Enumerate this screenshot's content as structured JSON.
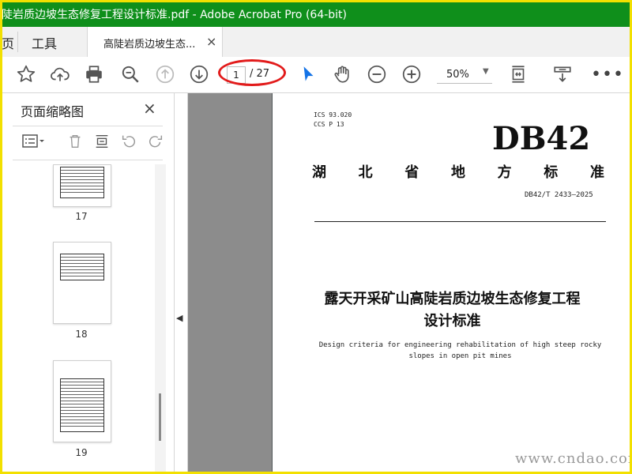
{
  "window": {
    "title": "陡岩质边坡生态修复工程设计标准.pdf - Adobe Acrobat Pro (64-bit)"
  },
  "menu": {
    "left_label": "页",
    "tools_label": "工具"
  },
  "tab": {
    "label": "高陡岩质边坡生态...",
    "close": "×"
  },
  "toolbar": {
    "page_current": "1",
    "page_total": "/ 27",
    "zoom": "50%",
    "zoom_arrow": "▼",
    "more": "•••",
    "icons": [
      "star-icon",
      "cloud-upload-icon",
      "print-icon",
      "search-zoom-icon",
      "page-up-icon",
      "page-down-icon",
      "select-arrow-icon",
      "hand-icon",
      "zoom-out-icon",
      "zoom-in-icon",
      "fit-page-icon",
      "scroll-mode-icon"
    ],
    "accent": "#1473e6",
    "highlight_color": "#e21b1b"
  },
  "sidebar": {
    "header": "页面缩略图",
    "close": "×",
    "thumbnails": [
      {
        "label": "17"
      },
      {
        "label": "18"
      },
      {
        "label": "19"
      }
    ]
  },
  "collapse_arrow": "◀",
  "document": {
    "ics": "ICS  93.020",
    "ccs": "CCS  P 13",
    "db": "DB42",
    "province_chars": [
      "湖",
      "北",
      "省",
      "地",
      "方",
      "标",
      "准"
    ],
    "code": "DB42/T 2433—2025",
    "title_line1": "露天开采矿山高陡岩质边坡生态修复工程",
    "title_line2": "设计标准",
    "english_line1": "Design criteria for engineering rehabilitation of high steep rocky",
    "english_line2": "slopes in open pit mines"
  },
  "watermark": "www.cndao.com",
  "colors": {
    "titlebar": "#0f8f1b",
    "frame": "#f2e000"
  }
}
